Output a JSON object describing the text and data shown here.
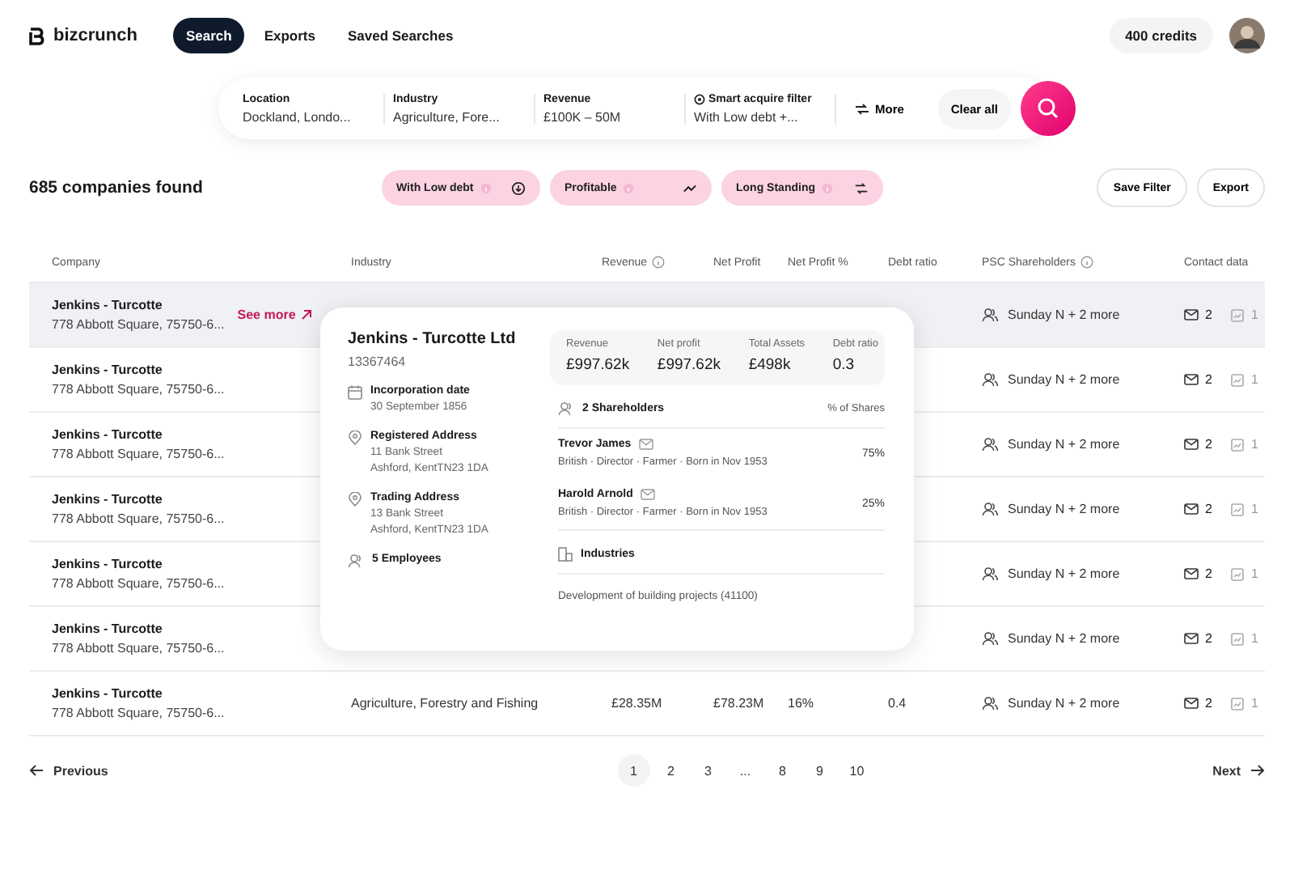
{
  "header": {
    "logo": "bizcrunch",
    "nav": [
      {
        "label": "Search",
        "selected": true
      },
      {
        "label": "Exports",
        "selected": false
      },
      {
        "label": "Saved Searches",
        "selected": false
      }
    ],
    "credits": "400 credits"
  },
  "search_bar": {
    "fields": [
      {
        "label": "Location",
        "value": "Dockland, Londo...",
        "kind": "plain"
      },
      {
        "label": "Industry",
        "value": "Agriculture, Fore...",
        "kind": "plain"
      },
      {
        "label": "Revenue",
        "value": "£100K – 50M",
        "kind": "plain"
      },
      {
        "label": "Smart acquire filter",
        "value": "With Low debt +...",
        "kind": "smart"
      }
    ],
    "more": "More",
    "clear": "Clear all"
  },
  "results": {
    "count": "685 companies found",
    "chips": [
      {
        "label": "With Low debt",
        "kind": "down"
      },
      {
        "label": "Profitable",
        "kind": "trend"
      },
      {
        "label": "Long Standing",
        "kind": "swap"
      }
    ],
    "actions": [
      "Save Filter",
      "Export"
    ]
  },
  "table": {
    "columns": [
      {
        "label": "Company",
        "info": false
      },
      {
        "label": "Industry",
        "info": false
      },
      {
        "label": "Revenue",
        "info": true
      },
      {
        "label": "Net Profit",
        "info": false
      },
      {
        "label": "Net Profit %",
        "info": false
      },
      {
        "label": "Debt ratio",
        "info": false
      },
      {
        "label": "PSC Shareholders",
        "info": true
      },
      {
        "label": "Contact data",
        "info": false
      }
    ],
    "rows": [
      {
        "name": "Jenkins - Turcotte",
        "address": "778 Abbott Square, 75750-6...",
        "selected": true,
        "link": "See more",
        "psc": "Sunday N + 2 more",
        "emails": "2",
        "phones": "1"
      },
      {
        "name": "Jenkins - Turcotte",
        "address": "778 Abbott Square, 75750-6...",
        "selected": false,
        "psc": "Sunday N + 2 more",
        "emails": "2",
        "phones": "1"
      },
      {
        "name": "Jenkins - Turcotte",
        "address": "778 Abbott Square, 75750-6...",
        "selected": false,
        "psc": "Sunday N + 2 more",
        "emails": "2",
        "phones": "1"
      },
      {
        "name": "Jenkins - Turcotte",
        "address": "778 Abbott Square, 75750-6...",
        "selected": false,
        "psc": "Sunday N + 2 more",
        "emails": "2",
        "phones": "1"
      },
      {
        "name": "Jenkins - Turcotte",
        "address": "778 Abbott Square, 75750-6...",
        "selected": false,
        "psc": "Sunday N + 2 more",
        "emails": "2",
        "phones": "1"
      },
      {
        "name": "Jenkins - Turcotte",
        "address": "778 Abbott Square, 75750-6...",
        "selected": false,
        "psc": "Sunday N + 2 more",
        "emails": "2",
        "phones": "1"
      },
      {
        "name": "Jenkins - Turcotte",
        "address": "778 Abbott Square, 75750-6...",
        "selected": false,
        "industry": "Agriculture, Forestry and Fishing",
        "revenue": "£28.35M",
        "net_profit": "£78.23M",
        "net_profit_pct": "16%",
        "debt_ratio": "0.4",
        "psc": "Sunday N + 2 more",
        "emails": "2",
        "phones": "1"
      }
    ]
  },
  "company_card": {
    "name": "Jenkins - Turcotte Ltd",
    "number": "13367464",
    "details": [
      {
        "kind": "date",
        "label": "Incorporation date",
        "lines": [
          "30 September 1856"
        ]
      },
      {
        "kind": "location",
        "label": "Registered Address",
        "lines": [
          "11 Bank Street",
          "Ashford, KentTN23 1DA"
        ]
      },
      {
        "kind": "location",
        "label": "Trading Address",
        "lines": [
          "13 Bank Street",
          "Ashford, KentTN23 1DA"
        ]
      },
      {
        "kind": "people",
        "label": "5 Employees"
      }
    ],
    "metrics": [
      {
        "label": "Revenue",
        "value": "£997.62k"
      },
      {
        "label": "Net profit",
        "value": "£997.62k"
      },
      {
        "label": "Total Assets",
        "value": "£498k"
      },
      {
        "label": "Debt ratio",
        "value": "0.3"
      }
    ],
    "shareholders": {
      "title": "2 Shareholders",
      "shares_heading": "% of Shares",
      "items": [
        {
          "name": "Trevor James",
          "info": "British · Director · Farmer · Born in Nov 1953",
          "share": "75%"
        },
        {
          "name": "Harold Arnold",
          "info": "British · Director · Farmer · Born in Nov 1953",
          "share": "25%"
        }
      ]
    },
    "industries": {
      "title": "Industries",
      "items": [
        "Development of building projects (41100)"
      ]
    }
  },
  "pagination": {
    "previous": "Previous",
    "next": "Next",
    "pages": [
      {
        "label": "1",
        "selected": true
      },
      {
        "label": "2",
        "selected": false
      },
      {
        "label": "3",
        "selected": false
      },
      {
        "label": "...",
        "selected": false
      },
      {
        "label": "8",
        "selected": false
      },
      {
        "label": "9",
        "selected": false
      },
      {
        "label": "10",
        "selected": false
      }
    ]
  }
}
